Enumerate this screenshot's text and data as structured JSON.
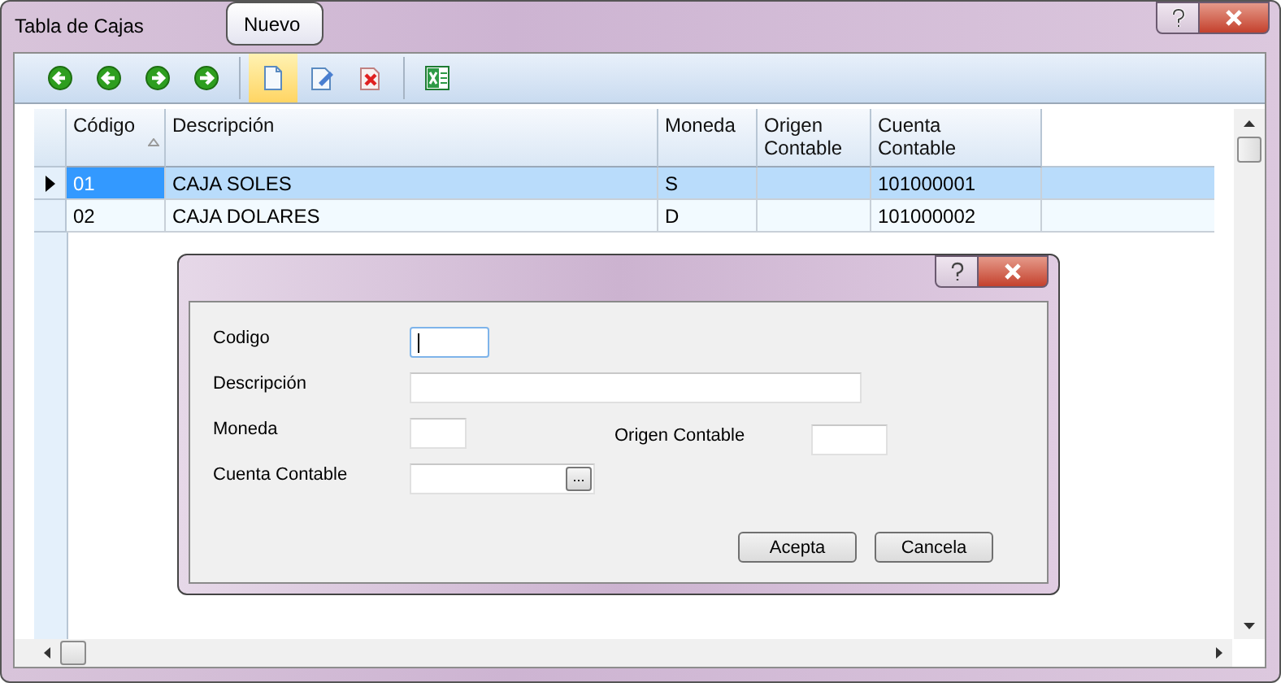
{
  "window": {
    "title": "Tabla de Cajas"
  },
  "toolbar": [
    {
      "kind": "first",
      "hovered": false
    },
    {
      "kind": "prev",
      "hovered": false
    },
    {
      "kind": "next",
      "hovered": false
    },
    {
      "kind": "last",
      "hovered": false
    },
    {
      "kind": "separator"
    },
    {
      "kind": "new",
      "hovered": true
    },
    {
      "kind": "edit",
      "hovered": false
    },
    {
      "kind": "delete",
      "hovered": false
    },
    {
      "kind": "separator"
    },
    {
      "kind": "excel",
      "hovered": false
    }
  ],
  "tooltip": "Nuevo",
  "table": {
    "columns": [
      {
        "label": "Código",
        "sorted": true
      },
      {
        "label": "Descripción",
        "sorted": false
      },
      {
        "label": "Moneda",
        "sorted": false
      },
      {
        "label": "Origen Contable",
        "sorted": false
      },
      {
        "label": "Cuenta Contable",
        "sorted": false
      }
    ],
    "rows": [
      {
        "selected": true,
        "cells": [
          "01",
          "CAJA SOLES",
          "S",
          "",
          "101000001"
        ]
      },
      {
        "selected": false,
        "cells": [
          "02",
          "CAJA DOLARES",
          "D",
          "",
          "101000002"
        ]
      }
    ]
  },
  "dialog": {
    "fields": [
      {
        "label": "Codigo",
        "focused": true
      },
      {
        "label": "Descripción",
        "focused": false
      },
      {
        "label": "Moneda",
        "focused": false
      },
      {
        "label": "Origen Contable",
        "focused": false
      },
      {
        "label": "Cuenta Contable",
        "focused": false,
        "browse": "..."
      }
    ],
    "buttons": [
      "Acepta",
      "Cancela"
    ]
  }
}
